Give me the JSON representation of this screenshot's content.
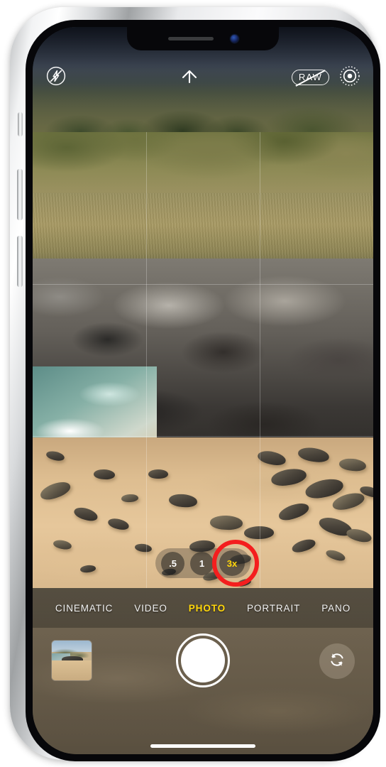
{
  "device": {
    "name": "iPhone",
    "frame_color": "#e9eaec",
    "hardware_buttons": [
      "silent-switch",
      "volume-up",
      "volume-down",
      "power"
    ]
  },
  "notch": {
    "speaker_label": "speaker-grille",
    "camera_label": "front-camera"
  },
  "app": {
    "name": "Camera",
    "accent_color": "#ffd60a",
    "annotation_color": "#f41e1e"
  },
  "top_controls": {
    "flash": {
      "name": "flash-off-icon",
      "label": "Flash Off",
      "state": "off"
    },
    "chevron": {
      "name": "chevron-up-icon",
      "label": "More Controls"
    },
    "raw": {
      "name": "raw-off-icon",
      "label": "RAW",
      "state": "off"
    },
    "live_photo": {
      "name": "live-photo-icon",
      "label": "Live Photo",
      "state": "on"
    }
  },
  "viewfinder": {
    "grid_enabled": true,
    "scene_description": "Sea turtles resting on a sandy beach with black volcanic rocks and ocean surf"
  },
  "zoom_controls": {
    "options": [
      {
        "label": ".5",
        "active": false
      },
      {
        "label": "1",
        "active": false
      },
      {
        "label": "3x",
        "active": true
      }
    ],
    "selected": "3x",
    "annotated": true
  },
  "mode_selector": {
    "modes": [
      {
        "label": "CINEMATIC",
        "active": false
      },
      {
        "label": "VIDEO",
        "active": false
      },
      {
        "label": "PHOTO",
        "active": true
      },
      {
        "label": "PORTRAIT",
        "active": false
      },
      {
        "label": "PANO",
        "active": false
      }
    ],
    "selected": "PHOTO"
  },
  "bottom_bar": {
    "thumbnail": {
      "name": "photo-thumbnail",
      "label": "Last Photo"
    },
    "shutter": {
      "name": "shutter-button",
      "label": "Take Photo"
    },
    "flip": {
      "name": "flip-camera-icon",
      "label": "Switch Camera"
    }
  },
  "home_indicator": {
    "label": "home-indicator"
  }
}
